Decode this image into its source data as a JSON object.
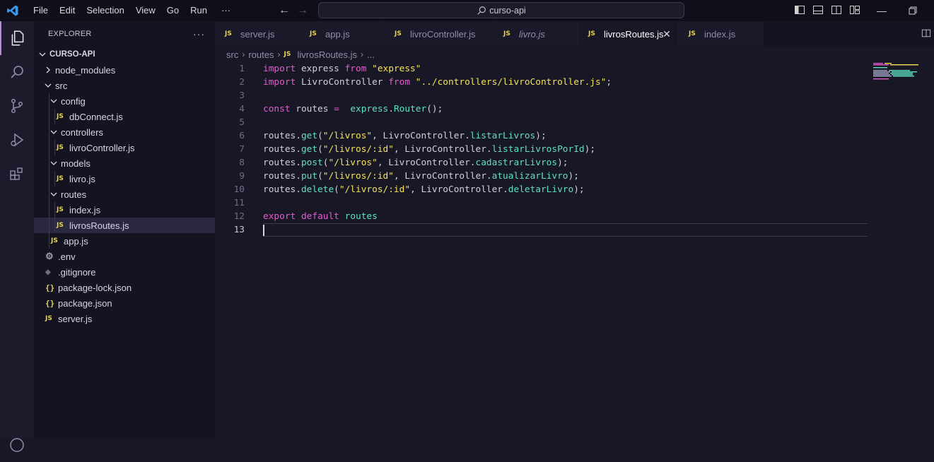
{
  "menu": [
    "File",
    "Edit",
    "Selection",
    "View",
    "Go",
    "Run",
    "···"
  ],
  "command_center": {
    "label": "curso-api"
  },
  "sidebar": {
    "title": "EXPLORER",
    "more": "···",
    "root": "CURSO-API",
    "tree": [
      {
        "label": "node_modules",
        "kind": "folder",
        "expanded": false,
        "depth": 1
      },
      {
        "label": "src",
        "kind": "folder",
        "expanded": true,
        "depth": 1
      },
      {
        "label": "config",
        "kind": "folder",
        "expanded": true,
        "depth": 2
      },
      {
        "label": "dbConnect.js",
        "kind": "js",
        "depth": 3
      },
      {
        "label": "controllers",
        "kind": "folder",
        "expanded": true,
        "depth": 2
      },
      {
        "label": "livroController.js",
        "kind": "js",
        "depth": 3
      },
      {
        "label": "models",
        "kind": "folder",
        "expanded": true,
        "depth": 2
      },
      {
        "label": "livro.js",
        "kind": "js",
        "depth": 3
      },
      {
        "label": "routes",
        "kind": "folder",
        "expanded": true,
        "depth": 2
      },
      {
        "label": "index.js",
        "kind": "js",
        "depth": 3
      },
      {
        "label": "livrosRoutes.js",
        "kind": "js",
        "depth": 3,
        "selected": true
      },
      {
        "label": "app.js",
        "kind": "js",
        "depth": 2
      },
      {
        "label": ".env",
        "kind": "gear",
        "depth": 1
      },
      {
        "label": ".gitignore",
        "kind": "diamond",
        "depth": 1
      },
      {
        "label": "package-lock.json",
        "kind": "json",
        "depth": 1
      },
      {
        "label": "package.json",
        "kind": "json",
        "depth": 1
      },
      {
        "label": "server.js",
        "kind": "js",
        "depth": 1
      }
    ]
  },
  "tabs": [
    {
      "label": "server.js",
      "italic": false,
      "active": false
    },
    {
      "label": "app.js",
      "italic": false,
      "active": false
    },
    {
      "label": "livroController.js",
      "italic": false,
      "active": false
    },
    {
      "label": "livro.js",
      "italic": true,
      "active": false
    },
    {
      "label": "livrosRoutes.js",
      "italic": false,
      "active": true
    },
    {
      "label": "index.js",
      "italic": false,
      "active": false
    }
  ],
  "tab_close": "✕",
  "breadcrumb": [
    "src",
    "routes",
    "livrosRoutes.js",
    "..."
  ],
  "js_badge": "JS",
  "json_badge": "{}",
  "code_lines": [
    [
      [
        "kw",
        "import"
      ],
      [
        "id",
        " express "
      ],
      [
        "kw",
        "from"
      ],
      [
        "id",
        " "
      ],
      [
        "str",
        "\"express\""
      ]
    ],
    [
      [
        "kw",
        "import"
      ],
      [
        "id",
        " LivroController "
      ],
      [
        "kw",
        "from"
      ],
      [
        "id",
        " "
      ],
      [
        "str",
        "\"../controllers/livroController.js\""
      ],
      [
        "id",
        ";"
      ]
    ],
    [],
    [
      [
        "kw",
        "const"
      ],
      [
        "id",
        " routes "
      ],
      [
        "op",
        "="
      ],
      [
        "id",
        "  "
      ],
      [
        "fn",
        "express"
      ],
      [
        "id",
        "."
      ],
      [
        "fn",
        "Router"
      ],
      [
        "id",
        "();"
      ]
    ],
    [],
    [
      [
        "id",
        "routes."
      ],
      [
        "fn",
        "get"
      ],
      [
        "id",
        "("
      ],
      [
        "str",
        "\"/livros\""
      ],
      [
        "id",
        ", LivroController."
      ],
      [
        "fn",
        "listarLivros"
      ],
      [
        "id",
        ");"
      ]
    ],
    [
      [
        "id",
        "routes."
      ],
      [
        "fn",
        "get"
      ],
      [
        "id",
        "("
      ],
      [
        "str",
        "\"/livros/:id\""
      ],
      [
        "id",
        ", LivroController."
      ],
      [
        "fn",
        "listarLivrosPorId"
      ],
      [
        "id",
        ");"
      ]
    ],
    [
      [
        "id",
        "routes."
      ],
      [
        "fn",
        "post"
      ],
      [
        "id",
        "("
      ],
      [
        "str",
        "\"/livros\""
      ],
      [
        "id",
        ", LivroController."
      ],
      [
        "fn",
        "cadastrarLivros"
      ],
      [
        "id",
        ");"
      ]
    ],
    [
      [
        "id",
        "routes."
      ],
      [
        "fn",
        "put"
      ],
      [
        "id",
        "("
      ],
      [
        "str",
        "\"/livros/:id\""
      ],
      [
        "id",
        ", LivroController."
      ],
      [
        "fn",
        "atualizarLivro"
      ],
      [
        "id",
        ");"
      ]
    ],
    [
      [
        "id",
        "routes."
      ],
      [
        "fn",
        "delete"
      ],
      [
        "id",
        "("
      ],
      [
        "str",
        "\"/livros/:id\""
      ],
      [
        "id",
        ", LivroController."
      ],
      [
        "fn",
        "deletarLivro"
      ],
      [
        "id",
        ");"
      ]
    ],
    [],
    [
      [
        "kw",
        "export"
      ],
      [
        "id",
        " "
      ],
      [
        "kw",
        "default"
      ],
      [
        "id",
        " "
      ],
      [
        "fn",
        "routes"
      ]
    ],
    []
  ],
  "current_line": 13,
  "colors": {
    "accent": "#b98bd6",
    "keyword": "#e85ad0",
    "string": "#f5e25a",
    "function": "#5fe0c3"
  }
}
